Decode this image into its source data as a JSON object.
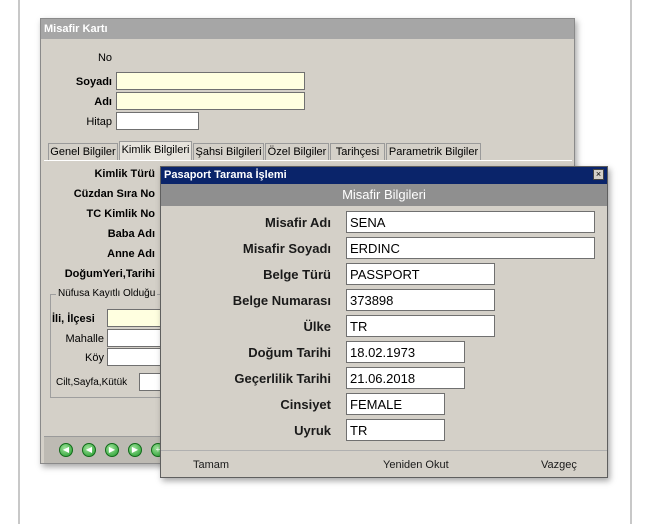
{
  "back_window": {
    "title": "Misafir Kartı",
    "fields": {
      "no_label": "No",
      "soyadi_label": "Soyadı",
      "adi_label": "Adı",
      "hitap_label": "Hitap"
    },
    "tabs": [
      "Genel Bilgiler",
      "Kimlik Bilgileri",
      "Şahsi Bilgileri",
      "Özel Bilgiler",
      "Tarihçesi",
      "Parametrik Bilgiler"
    ],
    "kimlik_labels": {
      "kimlik_turu": "Kimlik Türü",
      "cuzdan_sira_no": "Cüzdan Sıra No",
      "tc_kimlik_no": "TC Kimlik No",
      "baba_adi": "Baba Adı",
      "anne_adi": "Anne Adı",
      "dogum_yeri_tarihi": "DoğumYeri,Tarihi"
    },
    "nufus_group": {
      "caption": "Nüfusa Kayıtlı Olduğu",
      "ili_ilcesi": "İli, İlçesi",
      "mahalle": "Mahalle",
      "koy": "Köy",
      "cilt_sayfa_kutuk": "Cilt,Sayfa,Kütük"
    }
  },
  "dialog": {
    "title": "Pasaport Tarama İşlemi",
    "close_symbol": "×",
    "section_header": "Misafir Bilgileri",
    "rows": [
      {
        "label": "Misafir Adı",
        "value": "SENA"
      },
      {
        "label": "Misafir Soyadı",
        "value": "ERDINC"
      },
      {
        "label": "Belge Türü",
        "value": "PASSPORT"
      },
      {
        "label": "Belge Numarası",
        "value": "373898"
      },
      {
        "label": "Ülke",
        "value": "TR"
      },
      {
        "label": "Doğum Tarihi",
        "value": "18.02.1973"
      },
      {
        "label": "Geçerlilik Tarihi",
        "value": "21.06.2018"
      },
      {
        "label": "Cinsiyet",
        "value": "FEMALE"
      },
      {
        "label": "Uyruk",
        "value": "TR"
      }
    ],
    "buttons": {
      "ok": "Tamam",
      "rescan": "Yeniden Okut",
      "cancel": "Vazgeç"
    }
  }
}
